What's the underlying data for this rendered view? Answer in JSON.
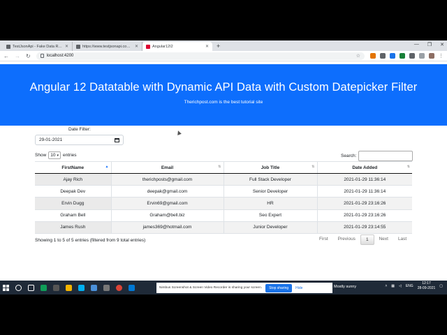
{
  "browser": {
    "tabs": [
      {
        "title": "TestJsonApi - Fake Data Rest API"
      },
      {
        "title": "https://www.testjsonapi.com/users"
      },
      {
        "title": "Angular12I2"
      }
    ],
    "url": "localhost:4200"
  },
  "hero": {
    "title": "Angular 12 Datatable with Dynamic API Data with Custom Datepicker Filter",
    "subtitle": "Therichpost.com is the best tutorial site"
  },
  "filter": {
    "label": "Date Filter:",
    "value": "29-01-2021"
  },
  "length": {
    "prefix": "Show",
    "value": "10",
    "suffix": "entries"
  },
  "search": {
    "label": "Search:"
  },
  "table": {
    "headers": [
      "FirstName",
      "Email",
      "Job Title",
      "Date Added"
    ],
    "rows": [
      [
        "Ajay Rich",
        "therichposts@gmail.com",
        "Full Stack Developer",
        "2021-01-29 11:36:14"
      ],
      [
        "Deepak Dev",
        "deepak@gmail.com",
        "Senior Developer",
        "2021-01-29 11:36:14"
      ],
      [
        "Ervin Dugg",
        "Ervin69@gmail.com",
        "HR",
        "2021-01-29 23:16:26"
      ],
      [
        "Graham Bell",
        "Graham@bell.biz",
        "Seo Expert",
        "2021-01-29 23:16:26"
      ],
      [
        "James Rush",
        "james369@hotmail.com",
        "Junior Developer",
        "2021-01-29 23:14:55"
      ]
    ]
  },
  "info": "Showing 1 to 5 of 5 entries (filtered from 9 total entries)",
  "pager": {
    "first": "First",
    "previous": "Previous",
    "current": "1",
    "next": "Next",
    "last": "Last"
  },
  "taskbar": {
    "notice": "Nimbus Screenshot & Screen Video Recorder is sharing your screen.",
    "stop": "Stop sharing",
    "hide": "Hide",
    "weather": "Mostly sunny",
    "lang": "ENG",
    "time": "12:17",
    "date": "28-09-2021"
  },
  "colors": {
    "hero": "#0d6efd",
    "taskbar": "#1f2a38"
  }
}
